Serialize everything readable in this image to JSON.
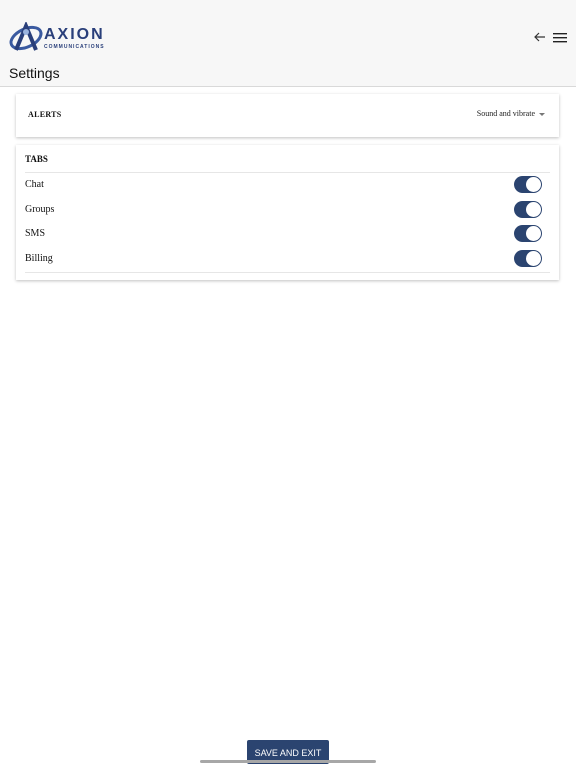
{
  "header": {
    "logo_name": "AXION",
    "logo_subtitle": "COMMUNICATIONS",
    "back_icon": "arrow-left-icon",
    "menu_icon": "hamburger-menu-icon"
  },
  "page": {
    "title": "Settings"
  },
  "alerts": {
    "label": "ALERTS",
    "selected_value": "Sound and vibrate"
  },
  "tabs": {
    "label": "TABS",
    "items": [
      {
        "label": "Chat",
        "enabled": true
      },
      {
        "label": "Groups",
        "enabled": true
      },
      {
        "label": "SMS",
        "enabled": true
      },
      {
        "label": "Billing",
        "enabled": true
      }
    ]
  },
  "footer": {
    "save_label": "SAVE AND EXIT"
  },
  "colors": {
    "accent": "#2b4470",
    "header_bg": "#f7f7f7"
  }
}
